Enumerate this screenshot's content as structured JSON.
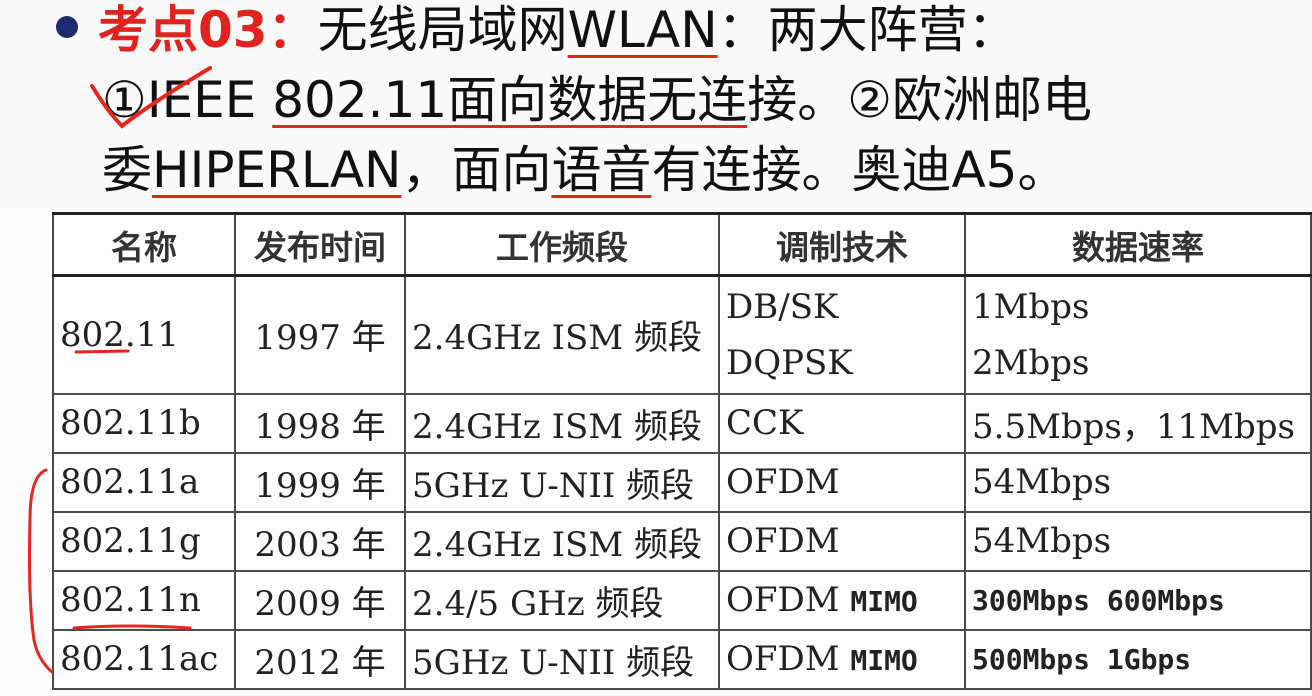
{
  "heading": {
    "prefix": "考点03：",
    "line1_a": "无线局域网",
    "line1_b": "WLAN",
    "line1_c": "：两大阵营：",
    "line2_a": "①IEEE ",
    "line2_b": "802.11面向数据无连",
    "line2_c": "接。②欧洲邮电",
    "line3_a": "委",
    "line3_b": "HIPERLAN",
    "line3_c": "，面向",
    "line3_d": "语音",
    "line3_e": "有连接。奥迪A5。"
  },
  "table": {
    "headers": [
      "名称",
      "发布时间",
      "工作频段",
      "调制技术",
      "数据速率"
    ],
    "rows": [
      {
        "name": "802.11",
        "year": "1997 年",
        "band": "2.4GHz ISM 频段",
        "mod1": "DB/SK",
        "mod2": "DQPSK",
        "rate1": "1Mbps",
        "rate2": "2Mbps"
      },
      {
        "name": "802.11b",
        "year": "1998 年",
        "band": "2.4GHz ISM 频段",
        "mod": "CCK",
        "rate": "5.5Mbps，11Mbps"
      },
      {
        "name": "802.11a",
        "year": "1999 年",
        "band": "5GHz U-NII 频段",
        "mod": "OFDM",
        "rate": "54Mbps"
      },
      {
        "name": "802.11g",
        "year": "2003 年",
        "band": "2.4GHz ISM 频段",
        "mod": "OFDM",
        "rate": "54Mbps"
      },
      {
        "name": "802.11n",
        "year": "2009 年",
        "band": "2.4/5 GHz   频段",
        "mod": "OFDM",
        "mod_extra": "MIMO",
        "rate": "300Mbps 600Mbps"
      },
      {
        "name": "802.11ac",
        "year": "2012 年",
        "band": "5GHz U-NII 频段",
        "mod": "OFDM",
        "mod_extra": "MIMO",
        "rate": "500Mbps 1Gbps"
      }
    ]
  },
  "colors": {
    "accent_red": "#e0231e",
    "bullet": "#1d2a6e",
    "ink": "#e5261f"
  }
}
